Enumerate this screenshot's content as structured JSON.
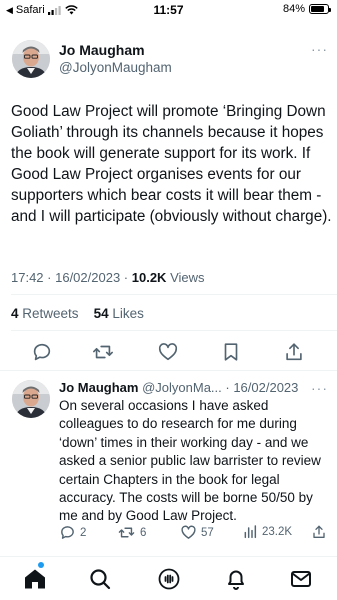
{
  "status_bar": {
    "back_app": "Safari",
    "time": "11:57",
    "battery": "84%",
    "battery_level": 0.84
  },
  "tweet": {
    "author_name": "Jo Maugham",
    "author_handle": "@JolyonMaugham",
    "text": "Good Law Project will promote ‘Bringing Down Goliath’ through its channels because it hopes the book will generate support for its work. If Good Law Project organises events for our supporters which bear costs it will bear them - and I will participate (obviously without charge).",
    "time": "17:42",
    "date": "16/02/2023",
    "views_count": "10.2K",
    "views_label": "Views",
    "retweets_count": "4",
    "retweets_label": "Retweets",
    "likes_count": "54",
    "likes_label": "Likes",
    "more": "···"
  },
  "reply": {
    "author_name": "Jo Maugham",
    "author_handle": "@JolyonMa...",
    "date": "· 16/02/2023",
    "more": "···",
    "text": "On several occasions I have asked colleagues to do research for me during ‘down’ times in their working day - and we asked a senior public law barrister to review certain Chapters in the book for legal accuracy. The costs will be borne 50/50 by me and by Good Law Project.",
    "replies": "2",
    "retweets": "6",
    "likes": "57",
    "views": "23.2K"
  },
  "icons": {
    "reply": "reply-icon",
    "retweet": "retweet-icon",
    "like": "heart-icon",
    "bookmark": "bookmark-icon",
    "share": "share-icon",
    "views": "views-icon",
    "home": "home-icon",
    "search": "search-icon",
    "spaces": "spaces-icon",
    "notifications": "bell-icon",
    "messages": "mail-icon"
  },
  "colors": {
    "accent": "#1d9bf0",
    "text": "#0f1419",
    "secondary": "#536471",
    "divider": "#eff3f4"
  }
}
